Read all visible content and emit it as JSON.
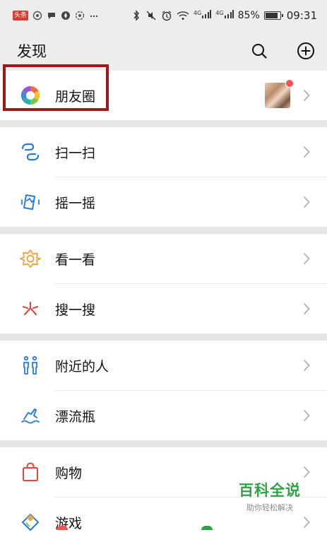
{
  "status_bar": {
    "app_badge": "头条",
    "battery_percent": "85%",
    "time": "09:31",
    "signal_1": "4G",
    "signal_2": "4G"
  },
  "header": {
    "title": "发现",
    "search_icon": "search-icon",
    "add_icon": "plus-circle-icon"
  },
  "sections": {
    "moments": {
      "label": "朋友圈",
      "icon": "moments-shutter-icon"
    },
    "scan": {
      "label": "扫一扫",
      "icon": "scan-icon"
    },
    "shake": {
      "label": "摇一摇",
      "icon": "shake-icon"
    },
    "top_stories": {
      "label": "看一看",
      "icon": "top-stories-icon"
    },
    "search": {
      "label": "搜一搜",
      "icon": "search-sparkle-icon"
    },
    "nearby": {
      "label": "附近的人",
      "icon": "people-nearby-icon"
    },
    "bottle": {
      "label": "漂流瓶",
      "icon": "drift-bottle-icon"
    },
    "shopping": {
      "label": "购物",
      "icon": "shopping-bag-icon"
    },
    "games": {
      "label": "游戏",
      "icon": "games-icon"
    }
  },
  "colors": {
    "background": "#ededed",
    "highlight_border": "#a3161a",
    "badge_red": "#fa5151",
    "watermark_green": "#2fa246"
  },
  "watermark": {
    "main": "百科全说",
    "sub": "助你轻松解决"
  }
}
